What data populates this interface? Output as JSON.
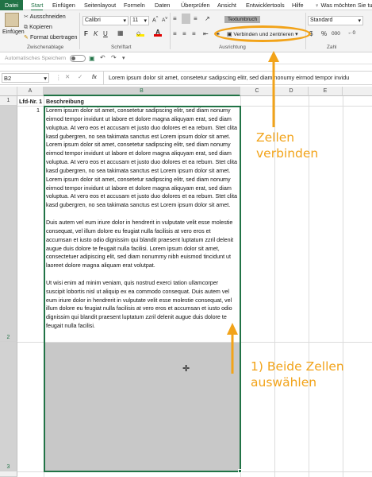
{
  "menu": {
    "tabs": [
      "Datei",
      "Start",
      "Einfügen",
      "Seitenlayout",
      "Formeln",
      "Daten",
      "Überprüfen",
      "Ansicht",
      "Entwicklertools",
      "Hilfe"
    ],
    "tell_me": "Was möchten Sie tun"
  },
  "clipboard": {
    "paste": "Einfügen",
    "cut": "Ausschneiden",
    "copy": "Kopieren",
    "format_painter": "Format übertragen",
    "group": "Zwischenablage"
  },
  "font": {
    "name": "Calibri",
    "size": "11",
    "group": "Schriftart",
    "bold": "F",
    "italic": "K",
    "underline": "U"
  },
  "alignment": {
    "wrap": "Textumbruch",
    "merge": "Verbinden und zentrieren",
    "group": "Ausrichtung"
  },
  "number": {
    "format": "Standard",
    "percent": "%",
    "thousands": "000",
    "group": "Zahl"
  },
  "qat": {
    "autosave": "Automatisches Speichern",
    "state": "Aus"
  },
  "formula_bar": {
    "name_box": "B2",
    "fx": "fx",
    "content": "Lorem ipsum dolor sit amet, consetetur sadipscing elitr, sed diam nonumy eirmod tempor invidu"
  },
  "columns": [
    "A",
    "B",
    "C",
    "D",
    "E"
  ],
  "rows": [
    "1",
    "2",
    "3"
  ],
  "cells": {
    "a1": "Lfd-Nr. 1",
    "b1": "Beschreibung",
    "a2": "1",
    "b2_paragraphs": [
      "Lorem ipsum dolor sit amet, consetetur sadipscing elitr, sed diam nonumy eirmod tempor invidunt ut labore et dolore magna aliquyam erat, sed diam voluptua. At vero eos et accusam et justo duo dolores et ea rebum. Stet clita kasd gubergren, no sea takimata sanctus est Lorem ipsum dolor sit amet. Lorem ipsum dolor sit amet, consetetur sadipscing elitr, sed diam nonumy eirmod tempor invidunt ut labore et dolore magna aliquyam erat, sed diam voluptua. At vero eos et accusam et justo duo dolores et ea rebum. Stet clita kasd gubergren, no sea takimata sanctus est Lorem ipsum dolor sit amet. Lorem ipsum dolor sit amet, consetetur sadipscing elitr, sed diam nonumy eirmod tempor invidunt ut labore et dolore magna aliquyam erat, sed diam voluptua. At vero eos et accusam et justo duo dolores et ea rebum. Stet clita kasd gubergren, no sea takimata sanctus est Lorem ipsum dolor sit amet.",
      "Duis autem vel eum iriure dolor in hendrerit in vulputate velit esse molestie consequat, vel illum dolore eu feugiat nulla facilisis at vero eros et accumsan et iusto odio dignissim qui blandit praesent luptatum zzril delenit augue duis dolore te feugait nulla facilisi. Lorem ipsum dolor sit amet, consectetuer adipiscing elit, sed diam nonummy nibh euismod tincidunt ut laoreet dolore magna aliquam erat volutpat.",
      "Ut wisi enim ad minim veniam, quis nostrud exerci tation ullamcorper suscipit lobortis nisl ut aliquip ex ea commodo consequat. Duis autem vel eum iriure dolor in hendrerit in vulputate velit esse molestie consequat, vel illum dolore eu feugiat nulla facilisis at vero eros et accumsan et iusto odio dignissim qui blandit praesent luptatum zzril delenit augue duis dolore te feugait nulla facilisi."
    ]
  },
  "annotations": {
    "merge_line1": "Zellen",
    "merge_line2": "verbinden",
    "select_line1": "1) Beide Zellen",
    "select_line2": "auswählen"
  },
  "colors": {
    "excel_green": "#217346",
    "annotation": "#f2a319",
    "selection": "#c8c8c8"
  }
}
